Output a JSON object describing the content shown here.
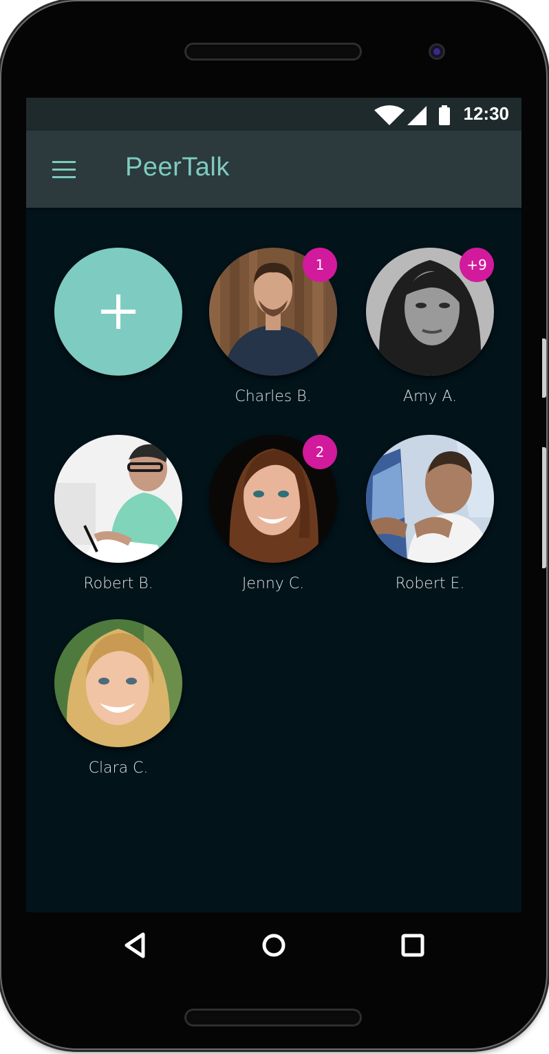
{
  "status_bar": {
    "time": "12:30"
  },
  "app_bar": {
    "title": "PeerTalk",
    "accent_color": "#7ecbc1"
  },
  "add_contact": {
    "icon": "plus-icon",
    "color": "#7ecbc1"
  },
  "contacts": [
    {
      "name": "Charles B.",
      "badge": "1"
    },
    {
      "name": "Amy A.",
      "badge": "+9"
    },
    {
      "name": "Robert B.",
      "badge": ""
    },
    {
      "name": "Jenny C.",
      "badge": "2"
    },
    {
      "name": "Robert E.",
      "badge": ""
    },
    {
      "name": "Clara C.",
      "badge": ""
    }
  ],
  "badge_color": "#d21a9c",
  "nav_bar": {
    "back_icon": "back-triangle-icon",
    "home_icon": "home-circle-icon",
    "recents_icon": "recents-square-icon"
  }
}
